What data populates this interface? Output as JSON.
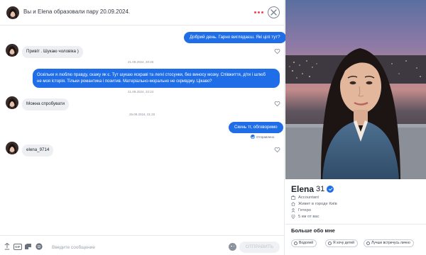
{
  "header": {
    "title": "Вы и Elena образовали пару 20.09.2024."
  },
  "messages": [
    {
      "direction": "out",
      "text": "Добрий день. Гарно виглядаєш. Які цілі тут?"
    },
    {
      "direction": "in",
      "text": "Привіт . Шукаю чоловіка )"
    },
    {
      "timestamp": "21.09.2024, 20:26"
    },
    {
      "direction": "out",
      "lines": [
        "Оскільки я люблю правду, скажу як є. Тут шукаю яскраві та легкі стосунки, без виносу мозку. Співжиття, діти і шлюб",
        "не моя історія. Тільки романтика і позитив. Матеріально-морально не скривджу. Цікаво?"
      ]
    },
    {
      "timestamp": "21.09.2024, 22:24"
    },
    {
      "direction": "in",
      "text": "Можна спробувати"
    },
    {
      "timestamp": "26.09.2024, 01:20"
    },
    {
      "direction": "out",
      "text": "Скинь тг, обговоримо",
      "status": "Отправлено"
    },
    {
      "direction": "in",
      "text": "elena_9714"
    }
  ],
  "composer": {
    "gif_label": "GIF",
    "placeholder": "Введите сообщение",
    "send_label": "ОТПРАВИТЬ"
  },
  "profile": {
    "name": "Elena",
    "age": "31",
    "job": "Accountant",
    "city": "Живет в городе Київ",
    "orientation": "Гетеро",
    "distance": "5 км от вас",
    "about_title": "Больше обо мне",
    "chips": [
      "Водолей",
      "Я хочу детей",
      "Лучше встречусь лично"
    ]
  },
  "colors": {
    "accent_blue": "#1f6ee8",
    "dots_red": "#fd3b57",
    "incoming_bubble": "#edeff2"
  }
}
